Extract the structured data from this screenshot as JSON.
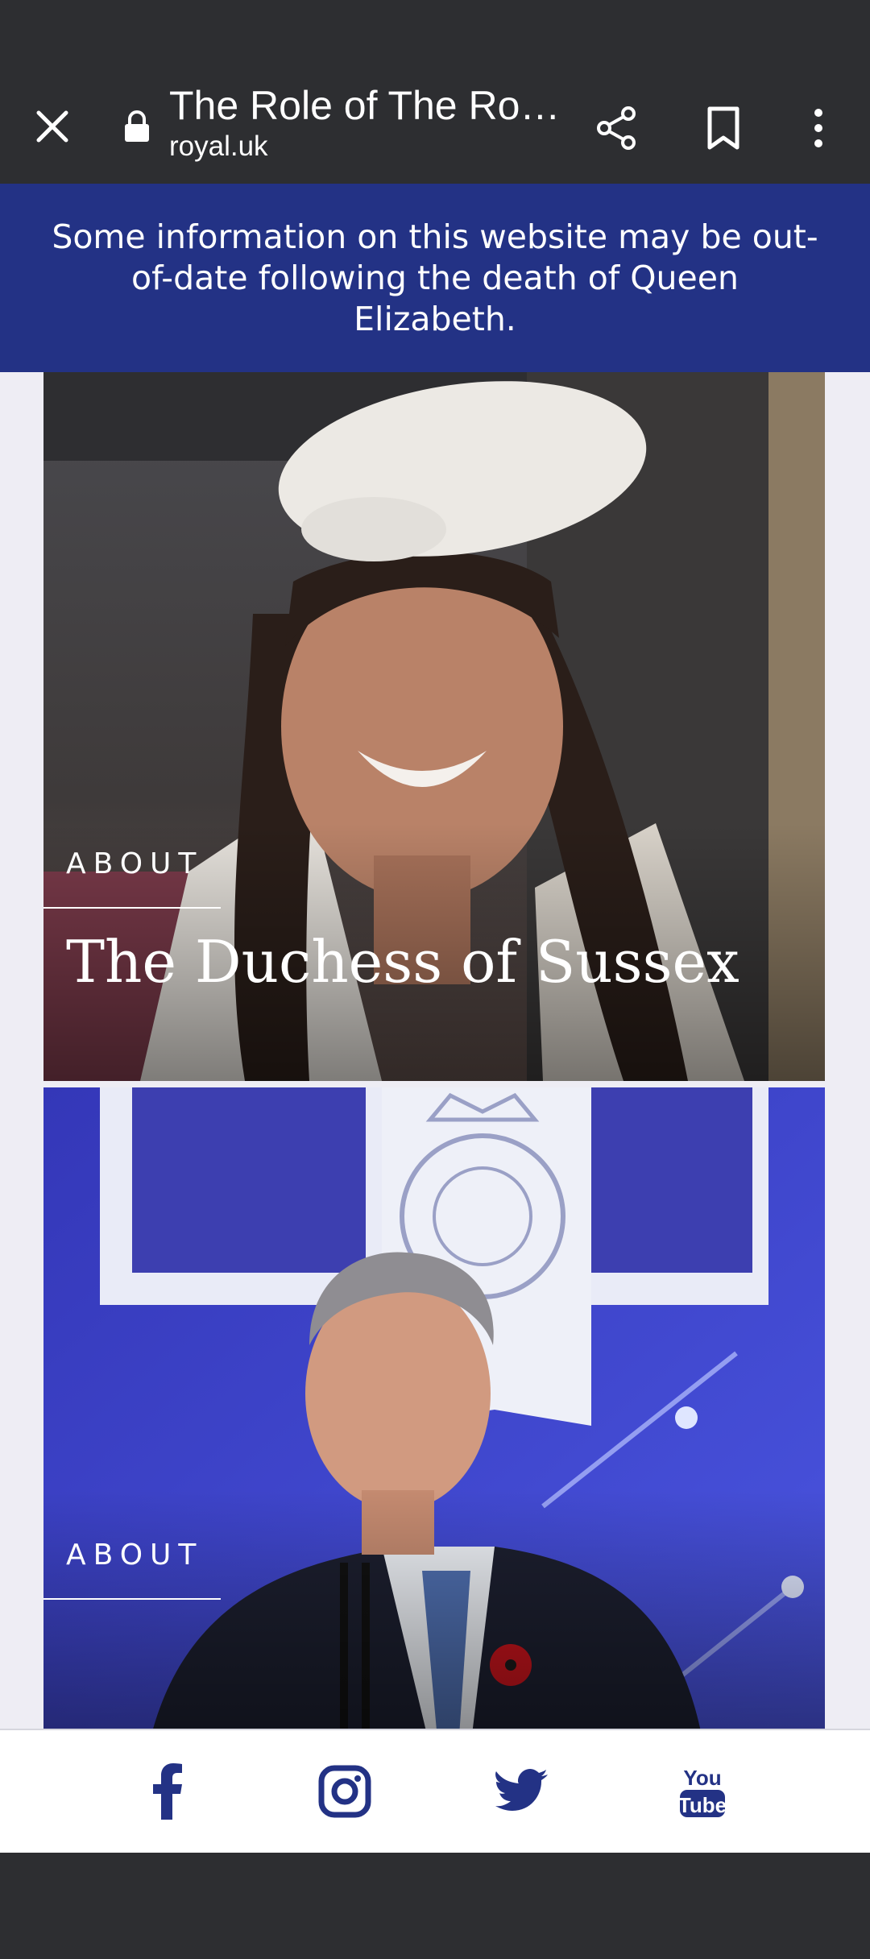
{
  "browser": {
    "page_title": "The Role of The Ro…",
    "domain": "royal.uk",
    "icons": [
      "close-icon",
      "lock-icon",
      "share-icon",
      "bookmark-icon",
      "more-vert-icon"
    ]
  },
  "banner": {
    "text": "Some information on this website may be out-of-date following the death of Queen Elizabeth."
  },
  "cards": [
    {
      "kicker": "ABOUT",
      "title": "The Duchess of Sussex"
    },
    {
      "kicker": "ABOUT",
      "title": ""
    }
  ],
  "social": {
    "items": [
      "facebook-icon",
      "instagram-icon",
      "twitter-icon",
      "youtube-icon"
    ],
    "youtube_line1": "You",
    "youtube_line2": "Tube",
    "color": "#233285"
  },
  "colors": {
    "chrome": "#2d2e31",
    "banner": "#233285",
    "page_bg": "#eeedf4"
  }
}
